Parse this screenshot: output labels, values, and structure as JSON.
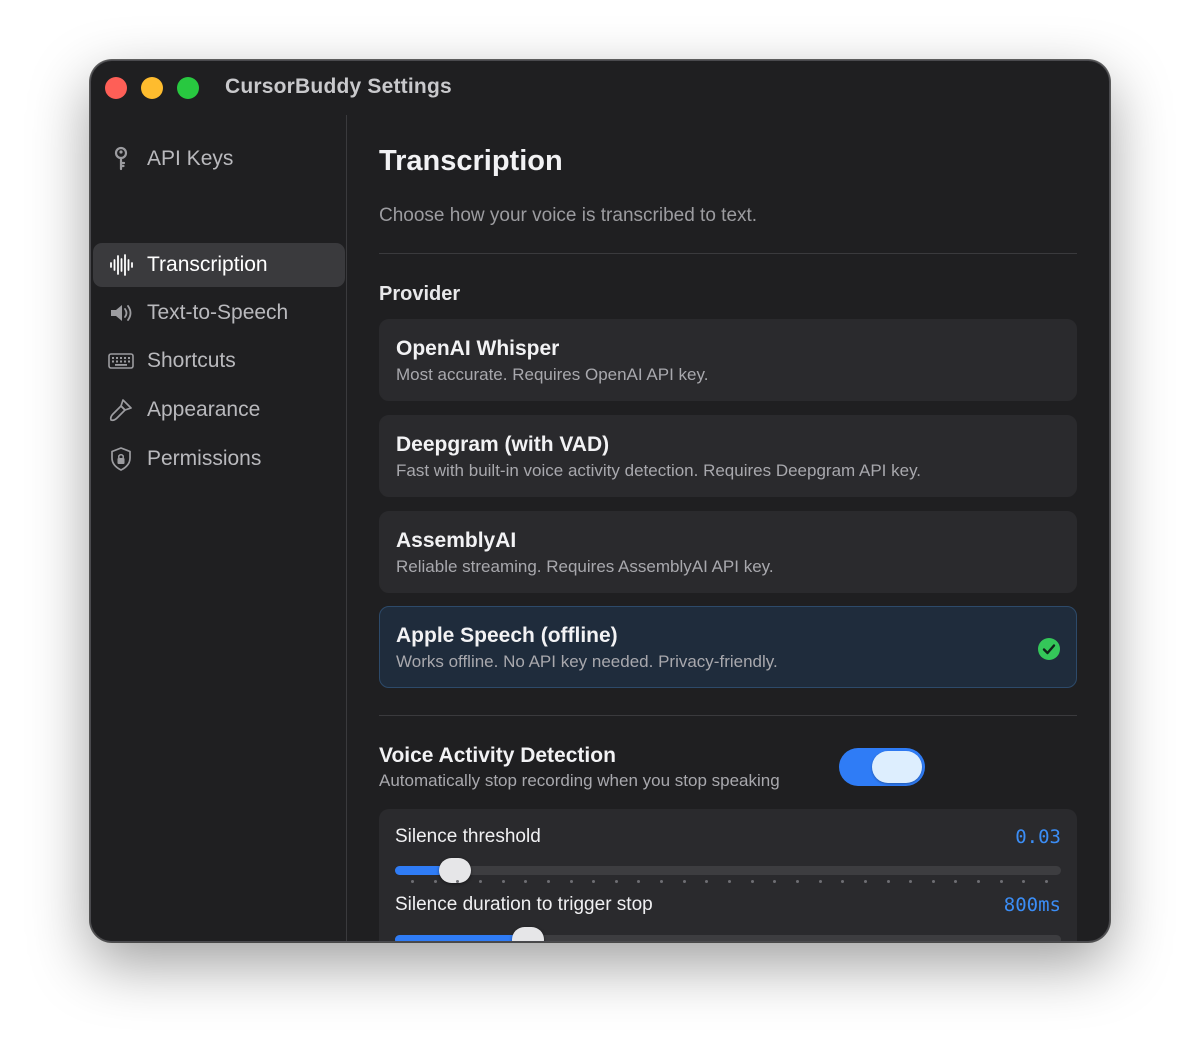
{
  "window": {
    "title": "CursorBuddy Settings"
  },
  "sidebar": {
    "items": [
      {
        "label": "API Keys",
        "icon": "key-icon"
      },
      {
        "label": "Transcription",
        "icon": "waveform-icon",
        "active": true
      },
      {
        "label": "Text-to-Speech",
        "icon": "speaker-icon"
      },
      {
        "label": "Shortcuts",
        "icon": "keyboard-icon"
      },
      {
        "label": "Appearance",
        "icon": "paintbrush-icon"
      },
      {
        "label": "Permissions",
        "icon": "shield-lock-icon"
      }
    ]
  },
  "main": {
    "title": "Transcription",
    "subtitle": "Choose how your voice is transcribed to text.",
    "provider_label": "Provider",
    "providers": [
      {
        "name": "OpenAI Whisper",
        "description": "Most accurate. Requires OpenAI API key."
      },
      {
        "name": "Deepgram (with VAD)",
        "description": "Fast with built-in voice activity detection. Requires Deepgram API key."
      },
      {
        "name": "AssemblyAI",
        "description": "Reliable streaming. Requires AssemblyAI API key."
      },
      {
        "name": "Apple Speech (offline)",
        "description": "Works offline. No API key needed. Privacy-friendly.",
        "selected": true
      }
    ],
    "vad": {
      "title": "Voice Activity Detection",
      "description": "Automatically stop recording when you stop speaking",
      "enabled": true
    },
    "sliders": [
      {
        "label": "Silence threshold",
        "value": "0.03",
        "fraction": 0.09
      },
      {
        "label": "Silence duration to trigger stop",
        "value": "800ms",
        "fraction": 0.2
      }
    ]
  },
  "colors": {
    "accent": "#2f7cf6",
    "selected_bg": "#1f2c3c",
    "check_green": "#34c759",
    "window_bg": "#1f1f21"
  }
}
